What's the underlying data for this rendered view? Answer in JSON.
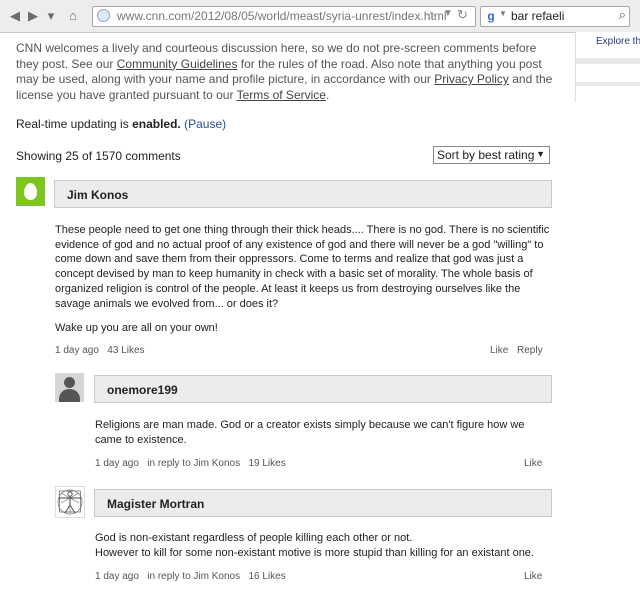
{
  "browser": {
    "url": "www.cnn.com/2012/08/05/world/meast/syria-unrest/index.html",
    "search_query": "bar refaeli"
  },
  "side_panel": {
    "explore_text": "Explore the"
  },
  "notice": {
    "part1": "CNN welcomes a lively and courteous discussion here, so we do not pre-screen comments before they post. See our ",
    "guidelines_link": "Community Guidelines",
    "part2": " for the rules of the road. Also note that anything you post may be used, along with your name and profile picture, in accordance with our ",
    "privacy_link": "Privacy Policy",
    "part3": " and the license you have granted pursuant to our ",
    "terms_link": "Terms of Service",
    "part4": "."
  },
  "realtime": {
    "prefix": "Real-time updating is ",
    "state": "enabled.",
    "pause_link": "(Pause)"
  },
  "comments_header": {
    "count_text": "Showing 25 of 1570 comments",
    "sort_selected": "Sort by best rating"
  },
  "comments": [
    {
      "author": "Jim Konos",
      "paragraphs": [
        "These people need to get one thing through their thick heads....  There is no god.  There is no scientific evidence of god and no actual proof of any existence of god and there will never be a god \"willing\" to come down and save them from their oppressors.  Come to terms and realize that god was just a concept devised by man to keep humanity in check with a basic set of morality.  The whole basis of organized religion is control of the people.  At least it keeps us from destroying ourselves like the savage animals we evolved from... or does it?",
        "Wake up you are all on your own!"
      ],
      "time": "1 day ago",
      "likes": "43 Likes",
      "like_label": "Like",
      "reply_label": "Reply"
    },
    {
      "author": "onemore199",
      "paragraphs": [
        "Religions are man made. God or a creator exists simply because we can't figure how we came to existence."
      ],
      "time": "1 day ago",
      "in_reply": "in reply to Jim Konos",
      "likes": "19 Likes",
      "like_label": "Like"
    },
    {
      "author": "Magister Mortran",
      "paragraphs": [
        "God is non-existant regardless of people killing each other or not.",
        "However to kill for some non-existant motive is more stupid than killing for an existant one."
      ],
      "time": "1 day ago",
      "in_reply": "in reply to Jim Konos",
      "likes": "16 Likes",
      "like_label": "Like"
    }
  ]
}
